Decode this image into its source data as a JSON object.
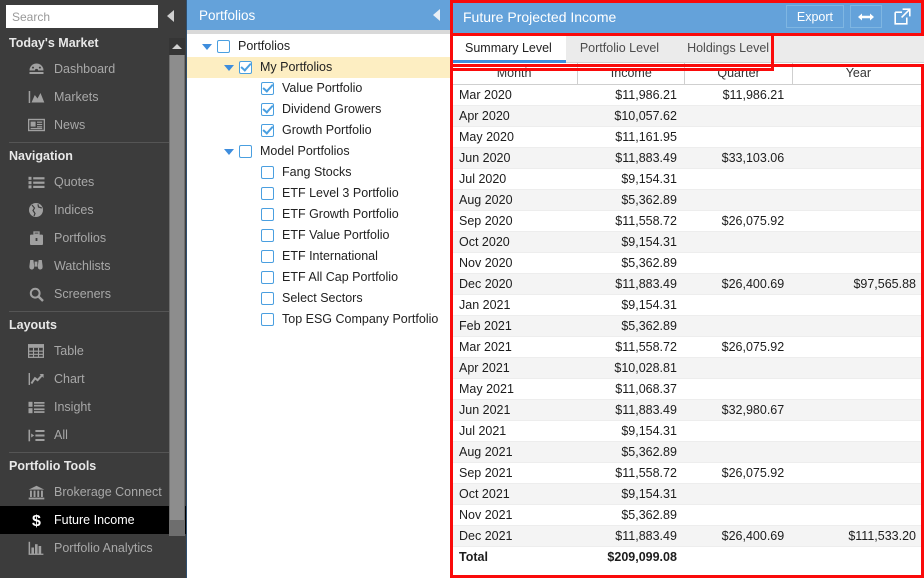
{
  "sidebar": {
    "search": {
      "placeholder": "Search",
      "value": ""
    },
    "collapse_icon": "triangle-left-icon",
    "sections": [
      {
        "title": "Today's Market",
        "items": [
          {
            "label": "Dashboard",
            "icon": "dashboard-gauge-icon",
            "active": false
          },
          {
            "label": "Markets",
            "icon": "area-chart-icon",
            "active": false
          },
          {
            "label": "News",
            "icon": "newspaper-icon",
            "active": false
          }
        ]
      },
      {
        "title": "Navigation",
        "items": [
          {
            "label": "Quotes",
            "icon": "list-icon",
            "active": false
          },
          {
            "label": "Indices",
            "icon": "globe-icon",
            "active": false
          },
          {
            "label": "Portfolios",
            "icon": "briefcase-icon",
            "active": false
          },
          {
            "label": "Watchlists",
            "icon": "binoculars-icon",
            "active": false
          },
          {
            "label": "Screeners",
            "icon": "magnifier-icon",
            "active": false
          }
        ]
      },
      {
        "title": "Layouts",
        "items": [
          {
            "label": "Table",
            "icon": "table-grid-icon",
            "active": false
          },
          {
            "label": "Chart",
            "icon": "line-chart-icon",
            "active": false
          },
          {
            "label": "Insight",
            "icon": "insight-list-icon",
            "active": false
          },
          {
            "label": "All",
            "icon": "all-list-icon",
            "active": false
          }
        ]
      },
      {
        "title": "Portfolio Tools",
        "items": [
          {
            "label": "Brokerage Connect",
            "icon": "bank-icon",
            "active": false
          },
          {
            "label": "Future Income",
            "icon": "dollar-sign-icon",
            "active": true
          },
          {
            "label": "Portfolio Analytics",
            "icon": "bar-chart-icon",
            "active": false
          }
        ]
      }
    ]
  },
  "tree": {
    "header_title": "Portfolios",
    "collapse_icon": "triangle-left-icon",
    "nodes": [
      {
        "label": "Portfolios",
        "depth": 0,
        "twisty": "down",
        "checked": false,
        "selected": false
      },
      {
        "label": "My Portfolios",
        "depth": 1,
        "twisty": "down",
        "checked": true,
        "selected": true
      },
      {
        "label": "Value Portfolio",
        "depth": 2,
        "twisty": "none",
        "checked": true,
        "selected": false
      },
      {
        "label": "Dividend Growers",
        "depth": 2,
        "twisty": "none",
        "checked": true,
        "selected": false
      },
      {
        "label": "Growth Portfolio",
        "depth": 2,
        "twisty": "none",
        "checked": true,
        "selected": false
      },
      {
        "label": "Model Portfolios",
        "depth": 1,
        "twisty": "down",
        "checked": false,
        "selected": false
      },
      {
        "label": "Fang Stocks",
        "depth": 2,
        "twisty": "none",
        "checked": false,
        "selected": false
      },
      {
        "label": "ETF Level 3 Portfolio",
        "depth": 2,
        "twisty": "none",
        "checked": false,
        "selected": false
      },
      {
        "label": "ETF Growth Portfolio",
        "depth": 2,
        "twisty": "none",
        "checked": false,
        "selected": false
      },
      {
        "label": "ETF Value Portfolio",
        "depth": 2,
        "twisty": "none",
        "checked": false,
        "selected": false
      },
      {
        "label": "ETF International",
        "depth": 2,
        "twisty": "none",
        "checked": false,
        "selected": false
      },
      {
        "label": "ETF All Cap Portfolio",
        "depth": 2,
        "twisty": "none",
        "checked": false,
        "selected": false
      },
      {
        "label": "Select Sectors",
        "depth": 2,
        "twisty": "none",
        "checked": false,
        "selected": false
      },
      {
        "label": "Top ESG Company Portfolio",
        "depth": 2,
        "twisty": "none",
        "checked": false,
        "selected": false
      }
    ]
  },
  "main": {
    "title": "Future Projected Income",
    "export_label": "Export",
    "resize_icon": "horizontal-resize-icon",
    "popout_icon": "pop-out-icon",
    "tabs": [
      {
        "label": "Summary Level",
        "active": true
      },
      {
        "label": "Portfolio Level",
        "active": false
      },
      {
        "label": "Holdings Level",
        "active": false
      }
    ],
    "table": {
      "columns": [
        "Month",
        "Income",
        "Quarter",
        "Year"
      ],
      "rows": [
        [
          "Mar 2020",
          "$11,986.21",
          "$11,986.21",
          ""
        ],
        [
          "Apr 2020",
          "$10,057.62",
          "",
          ""
        ],
        [
          "May 2020",
          "$11,161.95",
          "",
          ""
        ],
        [
          "Jun 2020",
          "$11,883.49",
          "$33,103.06",
          ""
        ],
        [
          "Jul 2020",
          "$9,154.31",
          "",
          ""
        ],
        [
          "Aug 2020",
          "$5,362.89",
          "",
          ""
        ],
        [
          "Sep 2020",
          "$11,558.72",
          "$26,075.92",
          ""
        ],
        [
          "Oct 2020",
          "$9,154.31",
          "",
          ""
        ],
        [
          "Nov 2020",
          "$5,362.89",
          "",
          ""
        ],
        [
          "Dec 2020",
          "$11,883.49",
          "$26,400.69",
          "$97,565.88"
        ],
        [
          "Jan 2021",
          "$9,154.31",
          "",
          ""
        ],
        [
          "Feb 2021",
          "$5,362.89",
          "",
          ""
        ],
        [
          "Mar 2021",
          "$11,558.72",
          "$26,075.92",
          ""
        ],
        [
          "Apr 2021",
          "$10,028.81",
          "",
          ""
        ],
        [
          "May 2021",
          "$11,068.37",
          "",
          ""
        ],
        [
          "Jun 2021",
          "$11,883.49",
          "$32,980.67",
          ""
        ],
        [
          "Jul 2021",
          "$9,154.31",
          "",
          ""
        ],
        [
          "Aug 2021",
          "$5,362.89",
          "",
          ""
        ],
        [
          "Sep 2021",
          "$11,558.72",
          "$26,075.92",
          ""
        ],
        [
          "Oct 2021",
          "$9,154.31",
          "",
          ""
        ],
        [
          "Nov 2021",
          "$5,362.89",
          "",
          ""
        ],
        [
          "Dec 2021",
          "$11,883.49",
          "$26,400.69",
          "$111,533.20"
        ]
      ],
      "total_row": [
        "Total",
        "$209,099.08",
        "",
        ""
      ]
    }
  },
  "colors": {
    "header_blue": "#64a2da",
    "sidebar_bg": "#3c3c3c",
    "tree_selected": "#fdeec2",
    "checkbox_blue": "#4a9fe0",
    "annotation_red": "#fa0a0a",
    "tab_active_underline": "#3e8ddd"
  }
}
